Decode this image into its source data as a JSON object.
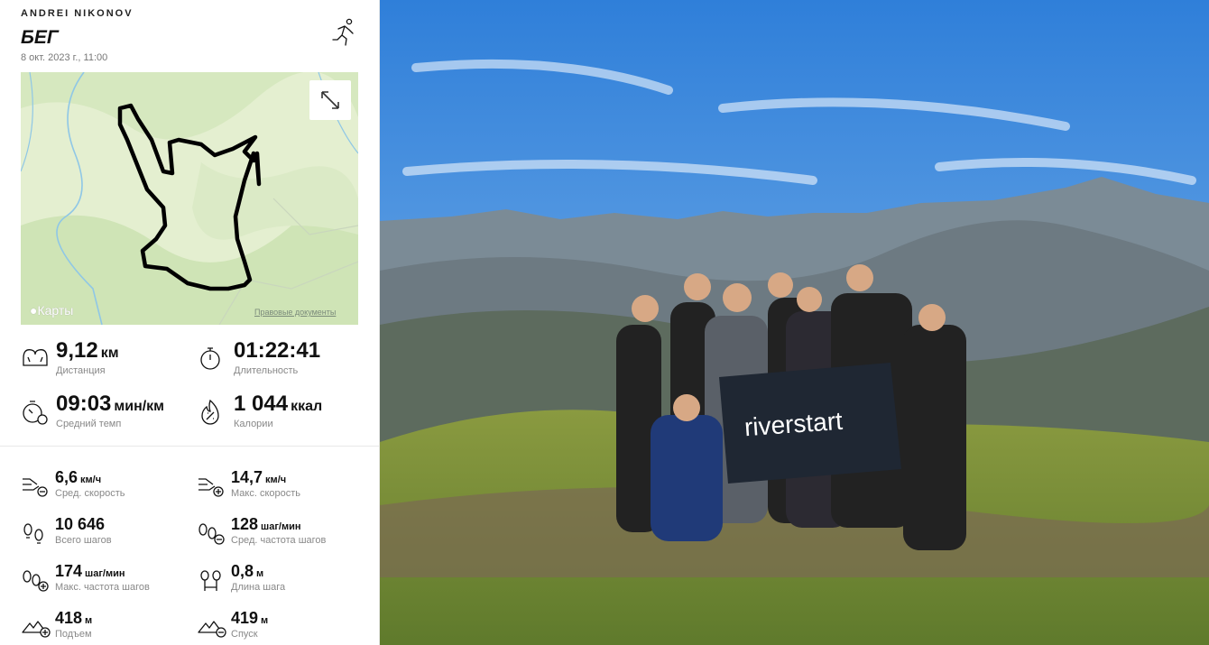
{
  "header": {
    "user": "ANDREI NIKONOV",
    "activity": "БЕГ",
    "date": "8 окт. 2023 г., 11:00"
  },
  "map": {
    "logo": "Карты",
    "legal": "Правовые документы",
    "expand_icon": "expand-icon"
  },
  "summary": [
    {
      "icon": "distance-icon",
      "value": "9,12",
      "unit": "км",
      "label": "Дистанция"
    },
    {
      "icon": "stopwatch-icon",
      "value": "01:22:41",
      "unit": "",
      "label": "Длительность"
    },
    {
      "icon": "pace-icon",
      "value": "09:03",
      "unit": "мин/км",
      "label": "Средний темп"
    },
    {
      "icon": "calories-icon",
      "value": "1 044",
      "unit": "ккал",
      "label": "Калории"
    }
  ],
  "details": [
    {
      "icon": "speed-avg-icon",
      "value": "6,6",
      "unit": "км/ч",
      "label": "Сред. скорость"
    },
    {
      "icon": "speed-max-icon",
      "value": "14,7",
      "unit": "км/ч",
      "label": "Макс. скорость"
    },
    {
      "icon": "steps-icon",
      "value": "10 646",
      "unit": "",
      "label": "Всего шагов"
    },
    {
      "icon": "cadence-avg-icon",
      "value": "128",
      "unit": "шаг/мин",
      "label": "Сред. частота шагов"
    },
    {
      "icon": "cadence-max-icon",
      "value": "174",
      "unit": "шаг/мин",
      "label": "Макс. частота шагов"
    },
    {
      "icon": "stride-icon",
      "value": "0,8",
      "unit": "м",
      "label": "Длина шага"
    },
    {
      "icon": "ascent-icon",
      "value": "418",
      "unit": "м",
      "label": "Подъем"
    },
    {
      "icon": "descent-icon",
      "value": "419",
      "unit": "м",
      "label": "Спуск"
    }
  ],
  "photo": {
    "banner_text": "riverstart"
  },
  "colors": {
    "sky_top": "#2f7fd9",
    "mountain": "#6d7a82",
    "grass": "#8a9a40",
    "route": "#000000",
    "map_bg": "#e3efcf"
  }
}
